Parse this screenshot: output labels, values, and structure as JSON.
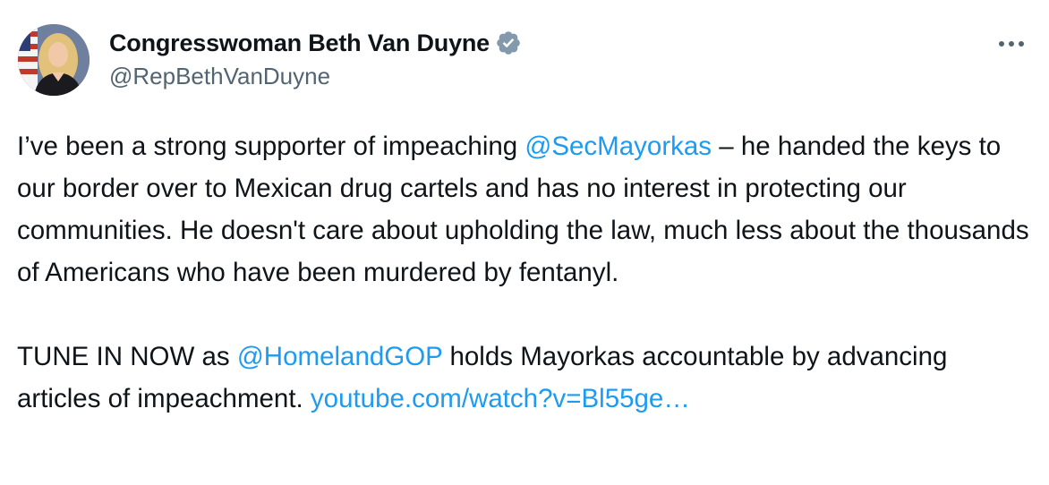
{
  "author": {
    "display_name": "Congresswoman Beth Van Duyne",
    "handle": "@RepBethVanDuyne",
    "verified_icon": "verified-badge-icon",
    "avatar_icon": "profile-photo"
  },
  "menu": {
    "more_icon": "more-options-icon"
  },
  "tweet": {
    "p1_seg1": "I’ve been a strong supporter of impeaching ",
    "p1_mention": "@SecMayorkas",
    "p1_seg2": " – he handed the keys to our border over to Mexican drug cartels and has no interest in protecting our communities. He doesn't care about upholding the law, much less about the thousands of Americans who have been murdered by fentanyl.",
    "p2_seg1": "TUNE IN NOW as ",
    "p2_mention": "@HomelandGOP",
    "p2_seg2": " holds Mayorkas accountable by advancing articles of impeachment. ",
    "p2_link": "youtube.com/watch?v=Bl55ge…"
  },
  "colors": {
    "text": "#0f1419",
    "secondary": "#536471",
    "link": "#1d9bf0",
    "verified_badge": "#829aab"
  }
}
